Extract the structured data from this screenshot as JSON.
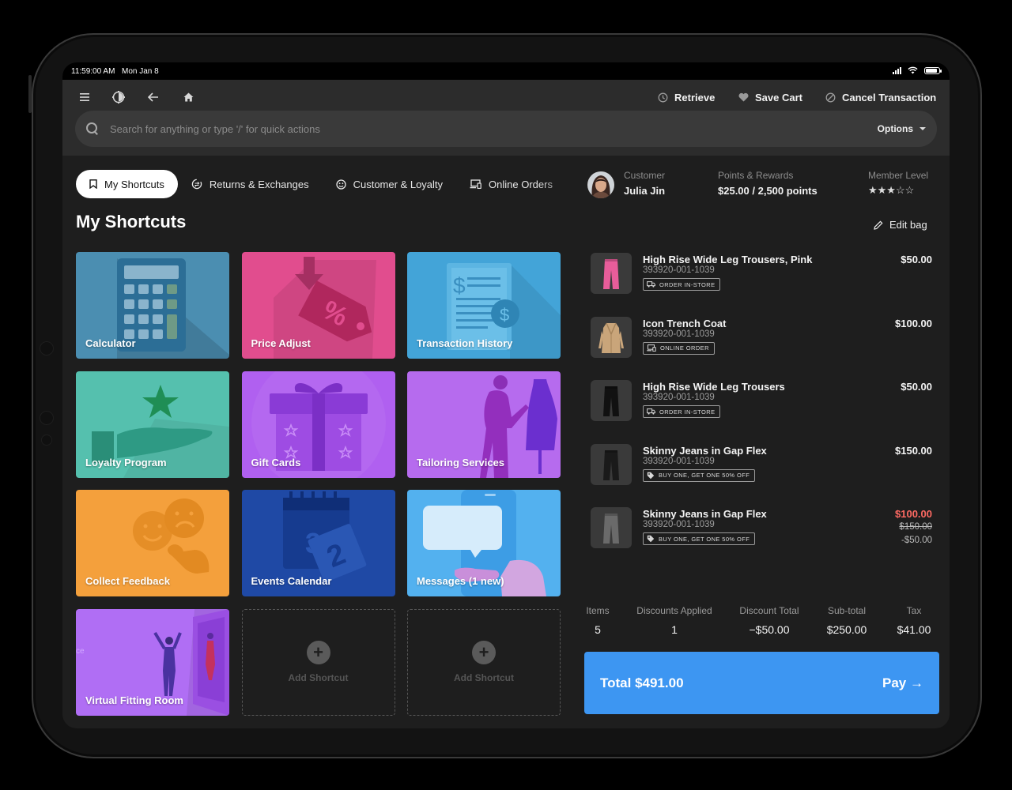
{
  "status_bar": {
    "time": "11:59:00 AM",
    "date": "Mon Jan 8",
    "battery_level": 0.9
  },
  "toolbar": {
    "icons": [
      "menu-icon",
      "theme-icon",
      "back-arrow-icon",
      "home-icon"
    ],
    "retrieve_label": "Retrieve",
    "save_cart_label": "Save Cart",
    "cancel_label": "Cancel Transaction"
  },
  "search": {
    "placeholder": "Search for anything or type '/' for quick actions",
    "options_label": "Options"
  },
  "tabs": [
    {
      "label": "My Shortcuts",
      "icon": "bookmark-icon",
      "active": true
    },
    {
      "label": "Returns & Exchanges",
      "icon": "exchange-icon",
      "active": false
    },
    {
      "label": "Customer & Loyalty",
      "icon": "smile-icon",
      "active": false
    },
    {
      "label": "Online Orders",
      "icon": "devices-icon",
      "active": false
    }
  ],
  "page_title": "My Shortcuts",
  "shortcuts": [
    {
      "label": "Calculator",
      "color": "#4b8eb1"
    },
    {
      "label": "Price Adjust",
      "color": "#e14d8e"
    },
    {
      "label": "Transaction History",
      "color": "#43a4d8"
    },
    {
      "label": "Loyalty Program",
      "color": "#55c0ae"
    },
    {
      "label": "Gift Cards",
      "color": "#b060f0"
    },
    {
      "label": "Tailoring Services",
      "color": "#b365ee"
    },
    {
      "label": "Collect Feedback",
      "color": "#f4a03c"
    },
    {
      "label": "Events Calendar",
      "color": "#1f49a5"
    },
    {
      "label": "Messages (1 new)",
      "color": "#53b1ef"
    },
    {
      "label": "Virtual Fitting Room",
      "color": "#b06ef4"
    }
  ],
  "add_shortcut_label": "Add Shortcut",
  "customer": {
    "customer_label": "Customer",
    "name": "Julia Jin",
    "points_label": "Points & Rewards",
    "points_value": "$25.00 / 2,500 points",
    "member_label": "Member Level",
    "member_rating": 3,
    "member_max": 5
  },
  "edit_bag_label": "Edit bag",
  "cart_items": [
    {
      "name": "High Rise Wide Leg Trousers, Pink",
      "sku": "393920-001-1039",
      "tag": "ORDER IN-STORE",
      "tag_icon": "truck-icon",
      "price": "$50.00",
      "thumb_color": "#e85d9a"
    },
    {
      "name": "Icon Trench Coat",
      "sku": "393920-001-1039",
      "tag": "ONLINE ORDER",
      "tag_icon": "devices-icon",
      "price": "$100.00",
      "thumb_color": "#c9a57a"
    },
    {
      "name": "High Rise Wide Leg Trousers",
      "sku": "393920-001-1039",
      "tag": "ORDER IN-STORE",
      "tag_icon": "truck-icon",
      "price": "$50.00",
      "thumb_color": "#111111"
    },
    {
      "name": "Skinny Jeans in Gap Flex",
      "sku": "393920-001-1039",
      "tag": "BUY ONE, GET ONE 50% OFF",
      "tag_icon": "tag-icon",
      "price": "$150.00",
      "thumb_color": "#1a1a1a"
    },
    {
      "name": "Skinny Jeans in Gap Flex",
      "sku": "393920-001-1039",
      "tag": "BUY ONE, GET ONE 50% OFF",
      "tag_icon": "tag-icon",
      "price": "$100.00",
      "original_price": "$150.00",
      "discount": "-$50.00",
      "thumb_color": "#6a6a6a"
    }
  ],
  "summary": {
    "items_label": "Items",
    "items_value": "5",
    "discounts_label": "Discounts Applied",
    "discounts_value": "1",
    "discount_total_label": "Discount Total",
    "discount_total_value": "−$50.00",
    "subtotal_label": "Sub-total",
    "subtotal_value": "$250.00",
    "tax_label": "Tax",
    "tax_value": "$41.00"
  },
  "pay": {
    "total_label": "Total $491.00",
    "pay_label": "Pay →",
    "color": "#3d96f2"
  }
}
